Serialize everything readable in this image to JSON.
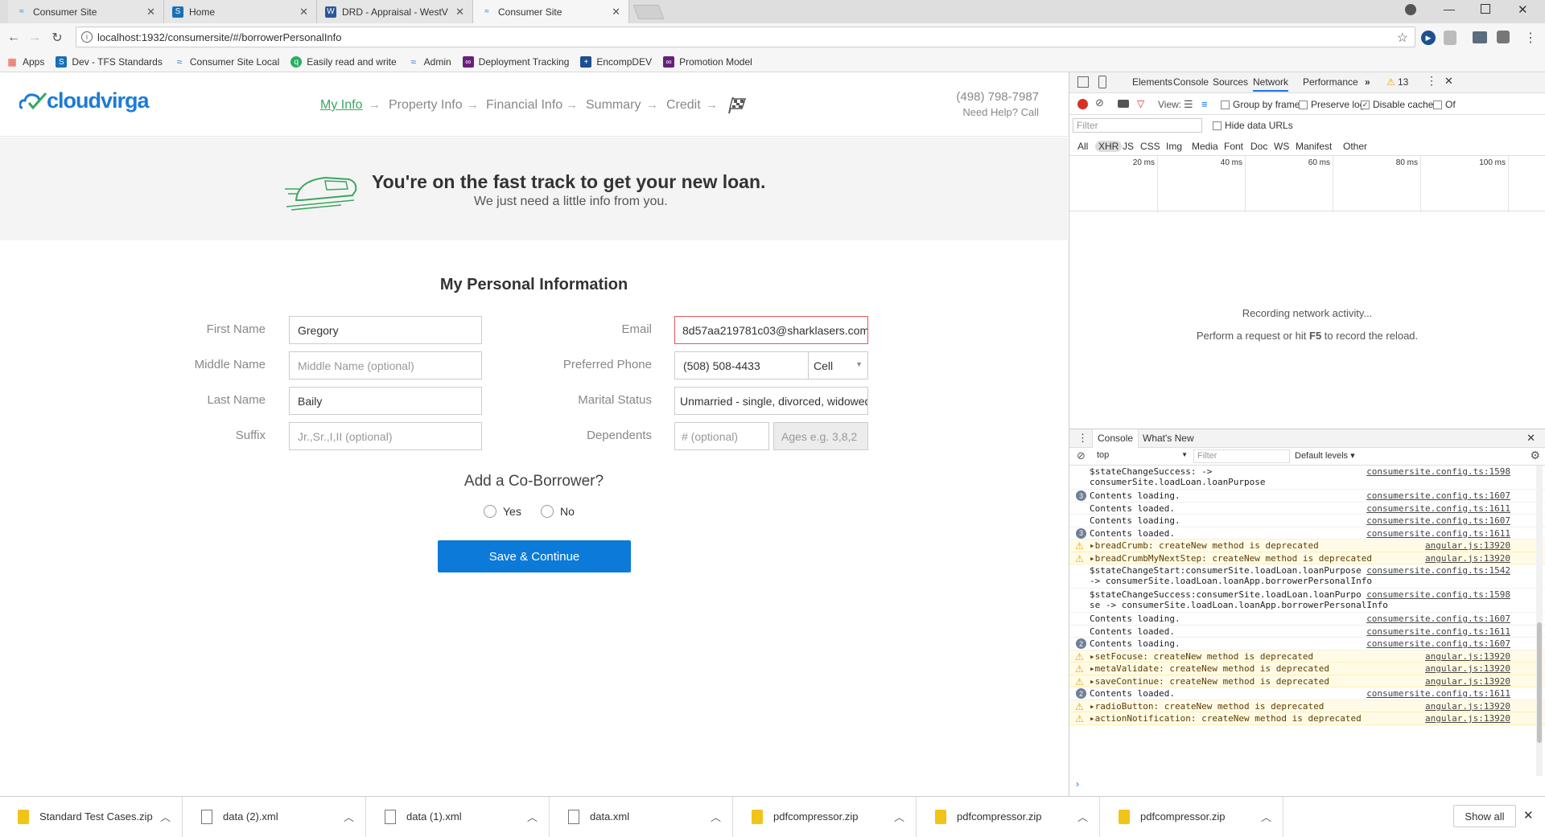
{
  "tabs": [
    {
      "label": "Consumer Site",
      "active": false
    },
    {
      "label": "Home",
      "active": false
    },
    {
      "label": "DRD - Appraisal - WestV",
      "active": false
    },
    {
      "label": "Consumer Site",
      "active": true
    }
  ],
  "address": {
    "url": "localhost:1932/consumersite/#/borrowerPersonalInfo"
  },
  "bookmarks": [
    {
      "label": "Apps"
    },
    {
      "label": "Dev - TFS Standards"
    },
    {
      "label": "Consumer Site Local"
    },
    {
      "label": "Easily read and write"
    },
    {
      "label": "Admin"
    },
    {
      "label": "Deployment Tracking"
    },
    {
      "label": "EncompDEV"
    },
    {
      "label": "Promotion Model"
    }
  ],
  "site": {
    "logo": "cloudvirga",
    "steps": [
      "My Info",
      "Property Info",
      "Financial Info",
      "Summary",
      "Credit"
    ],
    "phone": "(498) 798-7987",
    "help": "Need Help? Call",
    "hero_title": "You're on the fast track to get your new loan.",
    "hero_subtitle": "We just need a little info from you."
  },
  "form": {
    "title": "My Personal Information",
    "first_name_label": "First Name",
    "first_name_value": "Gregory",
    "middle_name_label": "Middle Name",
    "middle_name_placeholder": "Middle Name (optional)",
    "last_name_label": "Last Name",
    "last_name_value": "Baily",
    "suffix_label": "Suffix",
    "suffix_placeholder": "Jr.,Sr.,I,II (optional)",
    "email_label": "Email",
    "email_value": "8d57aa219781c03@sharklasers.com",
    "phone_label": "Preferred Phone",
    "phone_value": "(508) 508-4433",
    "phone_type": "Cell",
    "marital_label": "Marital Status",
    "marital_value": "Unmarried - single, divorced, widowed",
    "dependents_label": "Dependents",
    "dependents_placeholder": "# (optional)",
    "ages_placeholder": "Ages e.g. 3,8,2",
    "coborrower_question": "Add a Co-Borrower?",
    "yes_label": "Yes",
    "no_label": "No",
    "save_label": "Save & Continue"
  },
  "devtools": {
    "tabs": [
      "Elements",
      "Console",
      "Sources",
      "Network",
      "Performance"
    ],
    "active_tab": "Network",
    "warning_count": "13",
    "view_label": "View:",
    "group_by_frame": "Group by frame",
    "preserve_log": "Preserve log",
    "disable_cache": "Disable cache",
    "offline": "Of",
    "filter_placeholder": "Filter",
    "hide_data_urls": "Hide data URLs",
    "types": [
      "All",
      "XHR",
      "JS",
      "CSS",
      "Img",
      "Media",
      "Font",
      "Doc",
      "WS",
      "Manifest",
      "Other"
    ],
    "timeline_ticks": [
      "20 ms",
      "40 ms",
      "60 ms",
      "80 ms",
      "100 ms"
    ],
    "recording_msg": "Recording network activity...",
    "reload_msg_1": "Perform a request or hit ",
    "reload_msg_key": "F5",
    "reload_msg_2": " to record the reload.",
    "drawer_tabs": [
      "Console",
      "What's New"
    ],
    "context": "top",
    "console_filter": "Filter",
    "levels": "Default levels",
    "log": [
      {
        "type": "info",
        "badge": "",
        "text": "$stateChangeSuccess: ->\nconsumerSite.loadLoan.loanPurpose",
        "src": "consumersite.config.ts:1598"
      },
      {
        "type": "info",
        "badge": "3",
        "text": "Contents loading.",
        "src": "consumersite.config.ts:1607"
      },
      {
        "type": "info",
        "badge": "",
        "text": "Contents loaded.",
        "src": "consumersite.config.ts:1611"
      },
      {
        "type": "info",
        "badge": "",
        "text": "Contents loading.",
        "src": "consumersite.config.ts:1607"
      },
      {
        "type": "info",
        "badge": "3",
        "text": "Contents loaded.",
        "src": "consumersite.config.ts:1611"
      },
      {
        "type": "warn",
        "badge": "",
        "text": "▸breadCrumb: createNew method is deprecated",
        "src": "angular.js:13920"
      },
      {
        "type": "warn",
        "badge": "",
        "text": "▸breadCrumbMyNextStep: createNew method is deprecated",
        "src": "angular.js:13920"
      },
      {
        "type": "info",
        "badge": "",
        "text": "$stateChangeStart:consumerSite.loadLoan.loanPurpose\n-> consumerSite.loadLoan.loanApp.borrowerPersonalInfo",
        "src": "consumersite.config.ts:1542"
      },
      {
        "type": "info",
        "badge": "",
        "text": "$stateChangeSuccess:consumerSite.loadLoan.loanPurpo\nse -> consumerSite.loadLoan.loanApp.borrowerPersonalInfo",
        "src": "consumersite.config.ts:1598"
      },
      {
        "type": "info",
        "badge": "",
        "text": "Contents loading.",
        "src": "consumersite.config.ts:1607"
      },
      {
        "type": "info",
        "badge": "",
        "text": "Contents loaded.",
        "src": "consumersite.config.ts:1611"
      },
      {
        "type": "info",
        "badge": "2",
        "text": "Contents loading.",
        "src": "consumersite.config.ts:1607"
      },
      {
        "type": "warn",
        "badge": "",
        "text": "▸setFocuse: createNew method is deprecated",
        "src": "angular.js:13920"
      },
      {
        "type": "warn",
        "badge": "",
        "text": "▸metaValidate: createNew method is deprecated",
        "src": "angular.js:13920"
      },
      {
        "type": "warn",
        "badge": "",
        "text": "▸saveContinue: createNew method is deprecated",
        "src": "angular.js:13920"
      },
      {
        "type": "info",
        "badge": "2",
        "text": "Contents loaded.",
        "src": "consumersite.config.ts:1611"
      },
      {
        "type": "warn",
        "badge": "",
        "text": "▸radioButton: createNew method is deprecated",
        "src": "angular.js:13920"
      },
      {
        "type": "warn",
        "badge": "",
        "text": "▸actionNotification: createNew method is deprecated",
        "src": "angular.js:13920"
      }
    ]
  },
  "downloads": [
    {
      "name": "Standard Test Cases.zip",
      "icon": "zip-file-icon"
    },
    {
      "name": "data (2).xml",
      "icon": "file-icon"
    },
    {
      "name": "data (1).xml",
      "icon": "file-icon"
    },
    {
      "name": "data.xml",
      "icon": "file-icon"
    },
    {
      "name": "pdfcompressor.zip",
      "icon": "zip-file-icon"
    },
    {
      "name": "pdfcompressor.zip",
      "icon": "zip-file-icon"
    },
    {
      "name": "pdfcompressor.zip",
      "icon": "zip-file-icon"
    }
  ],
  "show_all_label": "Show all",
  "colors": {
    "brand_green": "#3aa760",
    "brand_blue": "#1d7bd7",
    "button_blue": "#0b7ad8",
    "error_red": "#e8555a"
  }
}
